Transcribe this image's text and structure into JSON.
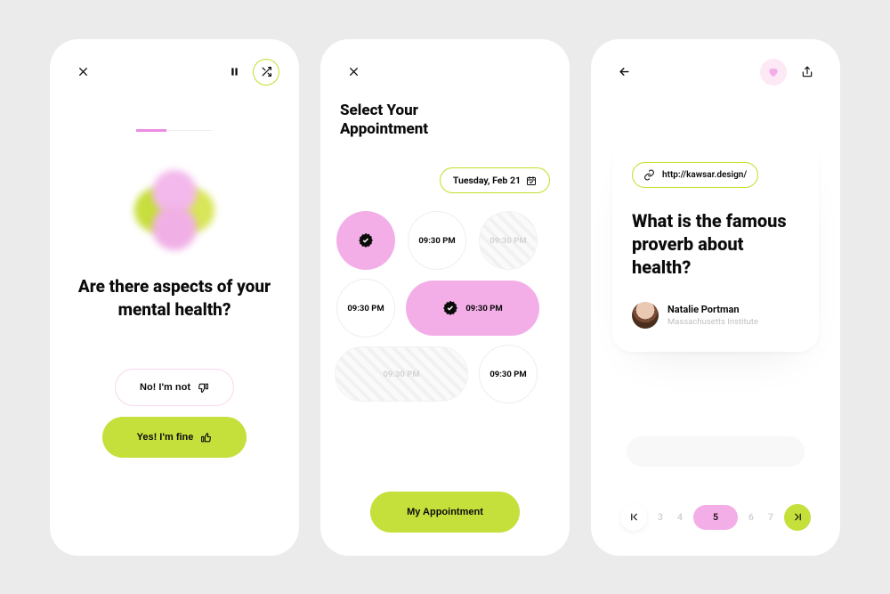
{
  "colors": {
    "lime": "#c5e03b",
    "pink": "#f3aee8",
    "ink": "#0b0b0b"
  },
  "screen1": {
    "icons": {
      "close": "close-icon",
      "pause": "pause-icon",
      "shuffle": "shuffle-icon"
    },
    "question": "Are there aspects of your mental health?",
    "no_label": "No! I'm not",
    "yes_label": "Yes! I'm fine"
  },
  "screen2": {
    "icons": {
      "close": "close-icon",
      "calendar": "calendar-icon",
      "verified": "verified-badge-icon"
    },
    "title_line1": "Select Your",
    "title_line2": "Appointment",
    "date_label": "Tuesday, Feb 21",
    "slots": [
      {
        "time": "",
        "state": "selected_icon_circle"
      },
      {
        "time": "09:30 PM",
        "state": "available_circle"
      },
      {
        "time": "09:30 PM",
        "state": "hatched_circle"
      },
      {
        "time": "09:30 PM",
        "state": "available_circle"
      },
      {
        "time": "09:30 PM",
        "state": "selected_icon_pill"
      },
      {
        "time": "09:30 PM",
        "state": "hatched_pill"
      },
      {
        "time": "09:30 PM",
        "state": "available_circle"
      }
    ],
    "cta_label": "My Appointment"
  },
  "screen3": {
    "icons": {
      "back": "arrow-left-icon",
      "heart": "heart-icon",
      "share": "share-icon",
      "link": "link-icon",
      "first": "first-page-icon",
      "last": "last-page-icon"
    },
    "link_text": "http://kawsar.design/",
    "question": "What is the famous proverb about health?",
    "author_name": "Natalie Portman",
    "author_affiliation": "Massachusetts Institute",
    "pages": [
      "3",
      "4",
      "5",
      "6",
      "7"
    ],
    "current_page": "5"
  }
}
